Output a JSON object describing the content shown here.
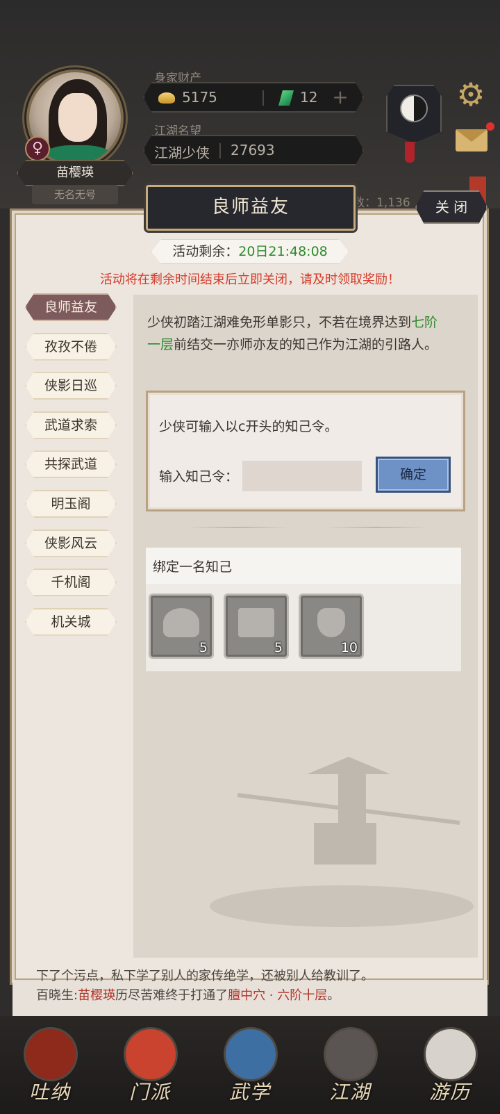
{
  "hud": {
    "character_name": "苗樱瑛",
    "character_title": "无名无号",
    "wealth_label": "身家财产",
    "gold": "5175",
    "jade": "12",
    "fame_label": "江湖名望",
    "fame_rank": "江湖少侠",
    "fame_value": "27693",
    "partial_stat": "数：1,136"
  },
  "panel": {
    "title": "良师益友",
    "close_label": "关 闭",
    "timer_label": "活动剩余：",
    "timer_value": "20日21:48:08",
    "warning": "活动将在剩余时间结束后立即关闭，请及时领取奖励！"
  },
  "sidebar": {
    "items": [
      {
        "label": "良师益友",
        "active": true
      },
      {
        "label": "孜孜不倦",
        "active": false
      },
      {
        "label": "侠影日巡",
        "active": false
      },
      {
        "label": "武道求索",
        "active": false
      },
      {
        "label": "共探武道",
        "active": false
      },
      {
        "label": "明玉阁",
        "active": false
      },
      {
        "label": "侠影风云",
        "active": false
      },
      {
        "label": "千机阁",
        "active": false
      },
      {
        "label": "机关城",
        "active": false
      }
    ]
  },
  "content": {
    "desc_part1": "少侠初踏江湖难免形单影只，不若在境界达到",
    "desc_highlight": "七阶一层",
    "desc_part2": "前结交一亦师亦友的知己作为江湖的引路人。",
    "hint": "少侠可输入以c开头的知己令。",
    "code_label": "输入知己令：",
    "code_value": "",
    "code_placeholder": "",
    "confirm_label": "确定",
    "bind_title": "绑定一名知己",
    "rewards": [
      {
        "icon": "silver-ingot-icon",
        "count": "5"
      },
      {
        "icon": "chest-icon",
        "count": "5"
      },
      {
        "icon": "incense-burner-icon",
        "count": "10"
      }
    ]
  },
  "ticker": {
    "line1": "下了个污点，私下学了别人的家传绝学，还被别人给教训了。",
    "line2_prefix": "百晓生:",
    "line2_name": "苗樱瑛",
    "line2_mid": "历尽苦难终于打通了",
    "line2_point": "膻中穴 · 六阶十层",
    "line2_end": "。"
  },
  "nav": {
    "items": [
      {
        "label": "吐纳",
        "icon": "breathing-icon",
        "color": "#8d2a1c"
      },
      {
        "label": "门派",
        "icon": "sect-banner-icon",
        "color": "#c9432e"
      },
      {
        "label": "武学",
        "icon": "martial-book-icon",
        "color": "#3d6fa3"
      },
      {
        "label": "江湖",
        "icon": "bamboo-hat-icon",
        "color": "#5a5552"
      },
      {
        "label": "游历",
        "icon": "horse-icon",
        "color": "#d7d2cb"
      }
    ]
  }
}
